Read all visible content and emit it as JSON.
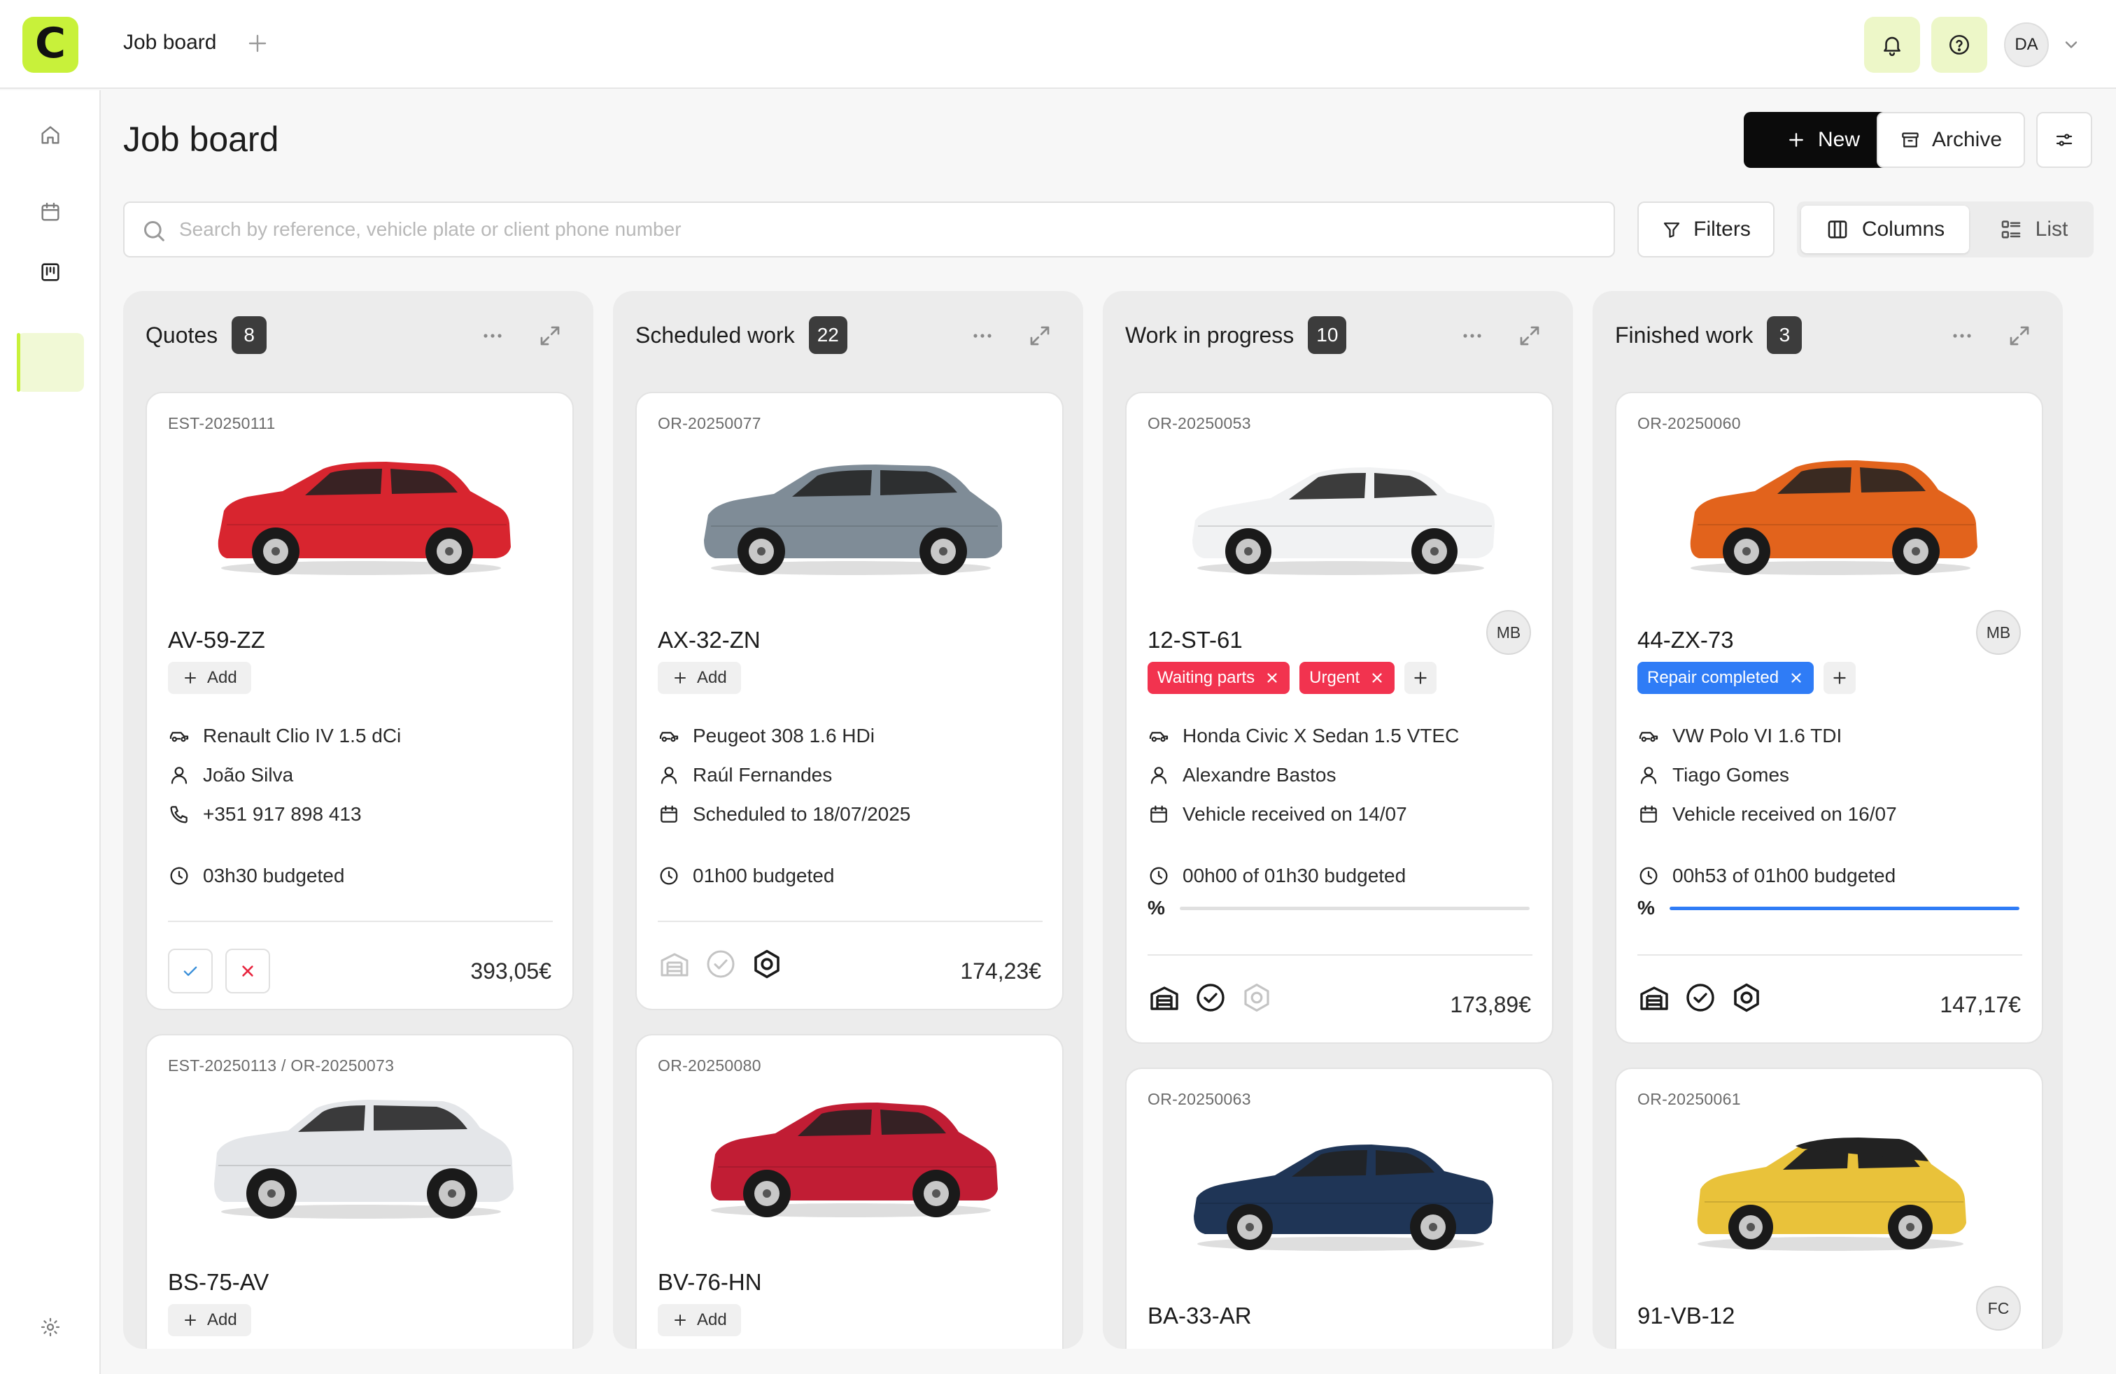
{
  "app": {
    "logo_letter": "C",
    "tab_title": "Job board",
    "user_initials": "DA"
  },
  "page": {
    "title": "Job board"
  },
  "toolbar": {
    "new_label": "New",
    "archive_label": "Archive",
    "filters_label": "Filters",
    "columns_label": "Columns",
    "list_label": "List"
  },
  "search": {
    "placeholder": "Search by reference, vehicle plate or client phone number",
    "value": ""
  },
  "colors": {
    "accent": "#c8f13a",
    "red_tag": "#f2334f",
    "blue_tag": "#2f7cf6",
    "quote_reject": "#e8263f",
    "quote_approve": "#3a8fd9"
  },
  "columns": [
    {
      "title": "Quotes",
      "count": "8",
      "cards": [
        {
          "ref": "EST-20250111",
          "plate": "AV-59-ZZ",
          "add_label": "Add",
          "vehicle": "Renault Clio IV 1.5 dCi",
          "client": "João Silva",
          "phone": "+351 917 898 413",
          "budget": "03h30 budgeted",
          "price": "393,05€",
          "car_color": "#d8252f"
        },
        {
          "ref": "EST-20250113 / OR-20250073",
          "plate": "BS-75-AV",
          "add_label": "Add",
          "car_color": "#e4e6e9"
        }
      ]
    },
    {
      "title": "Scheduled work",
      "count": "22",
      "cards": [
        {
          "ref": "OR-20250077",
          "plate": "AX-32-ZN",
          "add_label": "Add",
          "vehicle": "Peugeot 308 1.6 HDi",
          "client": "Raúl Fernandes",
          "scheduled": "Scheduled to 18/07/2025",
          "budget": "01h00 budgeted",
          "price": "174,23€",
          "car_color": "#7f8c97"
        },
        {
          "ref": "OR-20250080",
          "plate": "BV-76-HN",
          "add_label": "Add",
          "car_color": "#c11d34"
        }
      ]
    },
    {
      "title": "Work in progress",
      "count": "10",
      "cards": [
        {
          "ref": "OR-20250053",
          "plate": "12-ST-61",
          "assignee": "MB",
          "tags": [
            "Waiting parts",
            "Urgent"
          ],
          "vehicle": "Honda Civic X Sedan 1.5 VTEC",
          "client": "Alexandre Bastos",
          "received": "Vehicle received on 14/07",
          "budget": "00h00 of 01h30 budgeted",
          "progress": 0,
          "progress_label": "%",
          "price": "173,89€",
          "car_color": "#f1f2f3"
        },
        {
          "ref": "OR-20250063",
          "plate": "BA-33-AR",
          "car_color": "#1f3556"
        }
      ]
    },
    {
      "title": "Finished work",
      "count": "3",
      "cards": [
        {
          "ref": "OR-20250060",
          "plate": "44-ZX-73",
          "assignee": "MB",
          "tags": [
            "Repair completed"
          ],
          "vehicle": "VW Polo VI 1.6 TDI",
          "client": "Tiago Gomes",
          "received": "Vehicle received on 16/07",
          "budget": "00h53 of 01h00 budgeted",
          "progress": 1,
          "progress_label": "%",
          "price": "147,17€",
          "car_color": "#e2631c"
        },
        {
          "ref": "OR-20250061",
          "plate": "91-VB-12",
          "assignee": "FC",
          "car_color": "#e9c23a"
        }
      ]
    }
  ]
}
